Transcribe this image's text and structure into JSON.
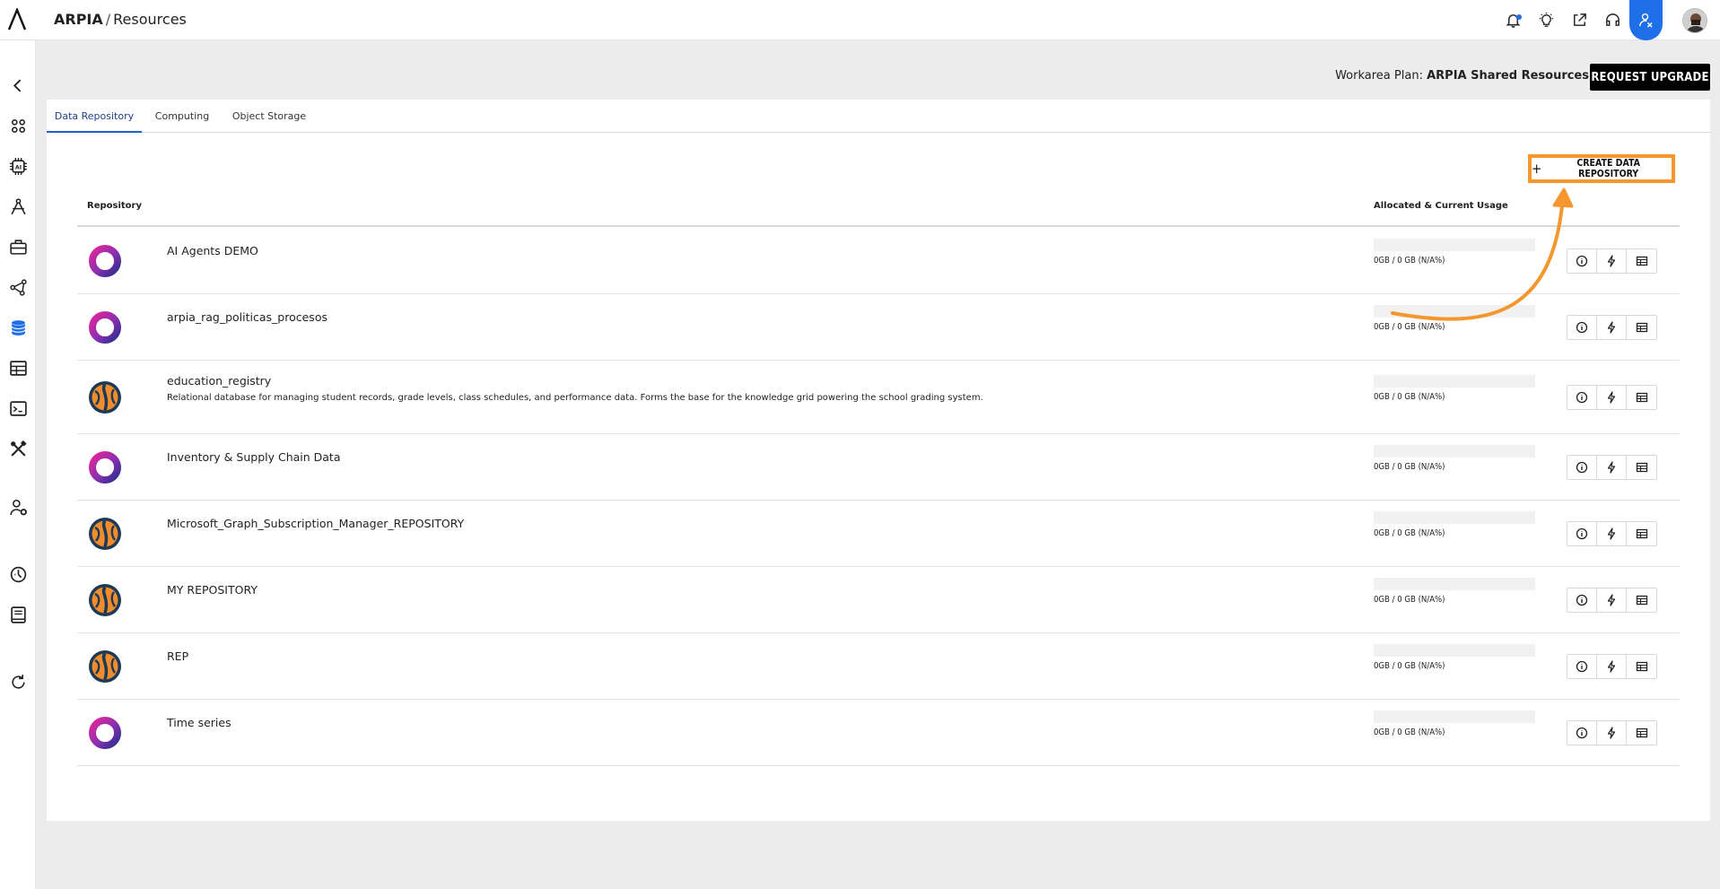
{
  "header": {
    "app_name": "ARPIA",
    "separator": "/",
    "section": "Resources",
    "icons": [
      "bell-icon",
      "lightbulb-icon",
      "share-icon",
      "headset-icon",
      "user-settings-icon"
    ]
  },
  "sidebar": {
    "items": [
      "back-icon",
      "apps-icon",
      "ai-chip-icon",
      "design-icon",
      "toolbox-icon",
      "graph-icon",
      "database-icon",
      "table-icon",
      "terminal-icon",
      "tools-icon",
      "user-gear-icon",
      "dashboard-icon",
      "book-icon",
      "refresh-icon"
    ],
    "active_color": "#1f6fe8"
  },
  "plan": {
    "label": "Workarea Plan:",
    "value": "ARPIA Shared Resources",
    "upgrade_label": "REQUEST UPGRADE"
  },
  "tabs": [
    {
      "label": "Data Repository",
      "active": true
    },
    {
      "label": "Computing",
      "active": false
    },
    {
      "label": "Object Storage",
      "active": false
    }
  ],
  "create_button": {
    "plus": "+",
    "label": "CREATE DATA REPOSITORY",
    "highlight_color": "#f5962e"
  },
  "table": {
    "col_repository": "Repository",
    "col_usage": "Allocated & Current Usage",
    "rows": [
      {
        "name": "AI Agents DEMO",
        "description": "",
        "usage": "0GB / 0 GB (N/A%)",
        "type": "ring"
      },
      {
        "name": "arpia_rag_politicas_procesos",
        "description": "",
        "usage": "0GB / 0 GB (N/A%)",
        "type": "ring"
      },
      {
        "name": "education_registry",
        "description": "Relational database for managing student records, grade levels, class schedules, and performance data. Forms the base for the knowledge grid powering the school grading system.",
        "usage": "0GB / 0 GB (N/A%)",
        "type": "mysql"
      },
      {
        "name": "Inventory & Supply Chain Data",
        "description": "",
        "usage": "0GB / 0 GB (N/A%)",
        "type": "ring"
      },
      {
        "name": "Microsoft_Graph_Subscription_Manager_REPOSITORY",
        "description": "",
        "usage": "0GB / 0 GB (N/A%)",
        "type": "mysql"
      },
      {
        "name": "MY REPOSITORY",
        "description": "",
        "usage": "0GB / 0 GB (N/A%)",
        "type": "mysql"
      },
      {
        "name": "REP",
        "description": "",
        "usage": "0GB / 0 GB (N/A%)",
        "type": "mysql"
      },
      {
        "name": "Time series",
        "description": "",
        "usage": "0GB / 0 GB (N/A%)",
        "type": "ring"
      }
    ],
    "row_actions": [
      "info-icon",
      "bolt-icon",
      "table-icon"
    ]
  }
}
